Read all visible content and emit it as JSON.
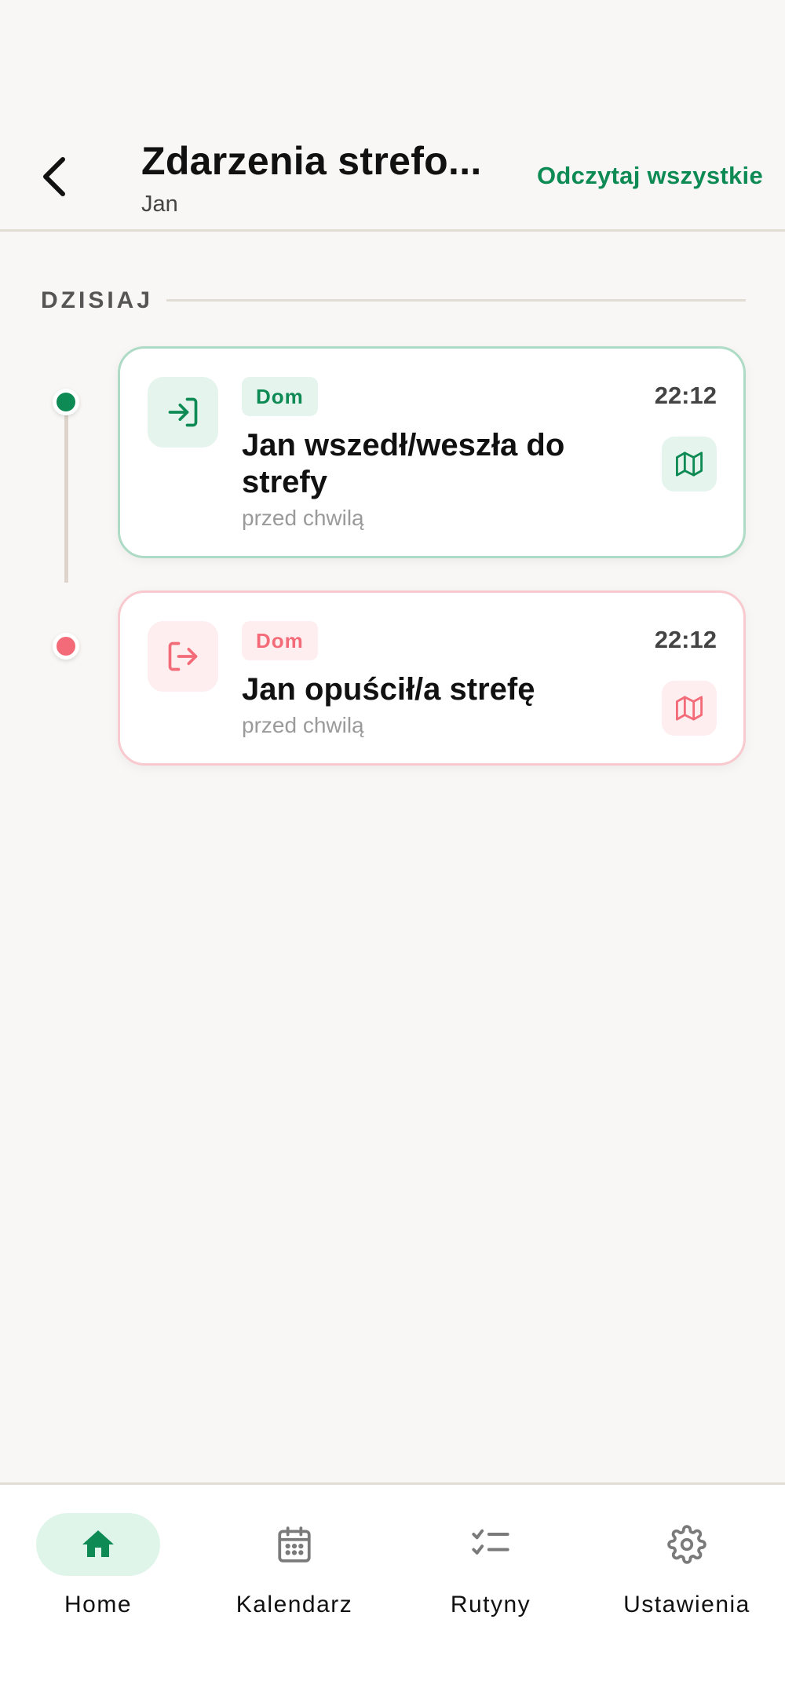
{
  "header": {
    "title": "Zdarzenia strefo...",
    "subtitle": "Jan",
    "read_all_label": "Odczytaj wszystkie"
  },
  "section": {
    "label": "DZISIAJ"
  },
  "events": [
    {
      "type": "enter",
      "zone": "Dom",
      "time": "22:12",
      "title": "Jan wszedł/weszła do strefy",
      "relative_time": "przed chwilą",
      "accent_color": "#0e8a55",
      "icon": "login-icon"
    },
    {
      "type": "exit",
      "zone": "Dom",
      "time": "22:12",
      "title": "Jan opuścił/a strefę",
      "relative_time": "przed chwilą",
      "accent_color": "#f36b78",
      "icon": "logout-icon"
    }
  ],
  "bottom_nav": {
    "items": [
      {
        "label": "Home",
        "icon": "home-icon",
        "active": true
      },
      {
        "label": "Kalendarz",
        "icon": "calendar-icon",
        "active": false
      },
      {
        "label": "Rutyny",
        "icon": "checklist-icon",
        "active": false
      },
      {
        "label": "Ustawienia",
        "icon": "gear-icon",
        "active": false
      }
    ]
  }
}
